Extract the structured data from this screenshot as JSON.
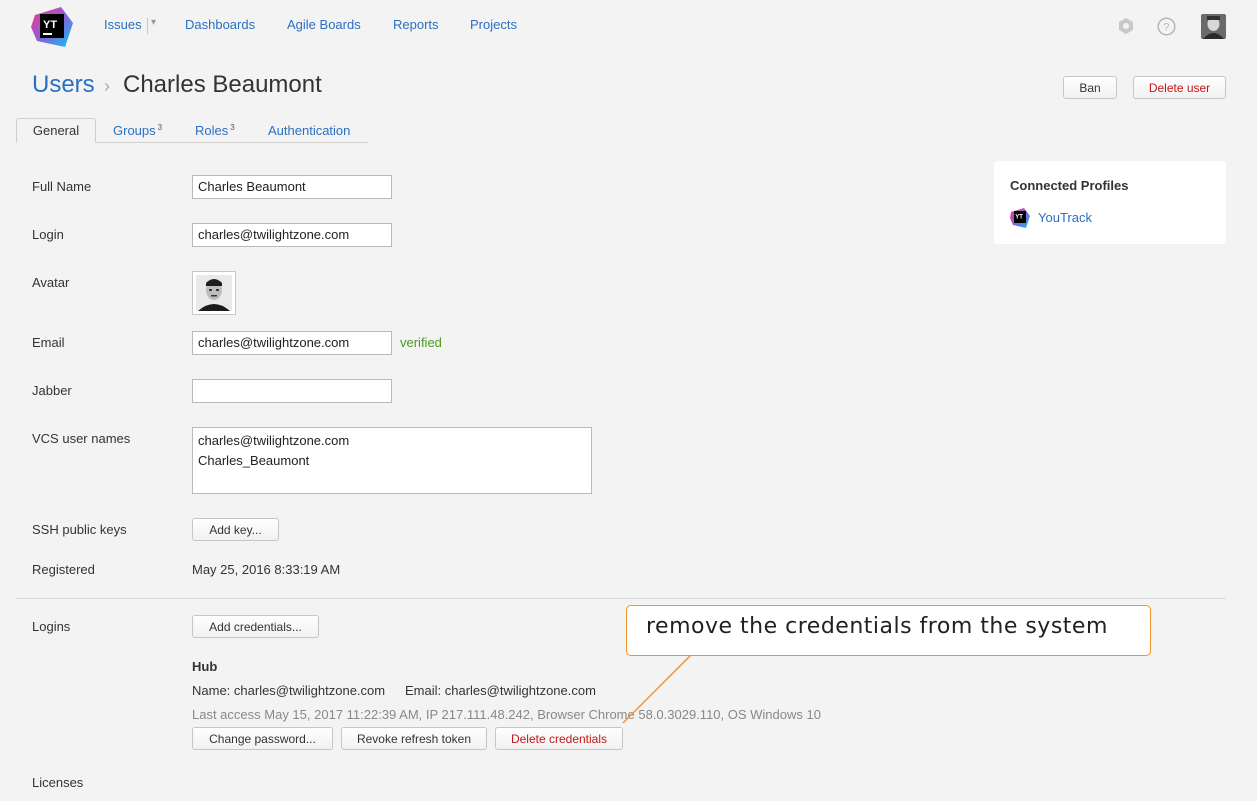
{
  "nav": {
    "items": [
      {
        "label": "Issues"
      },
      {
        "label": "Dashboards"
      },
      {
        "label": "Agile Boards"
      },
      {
        "label": "Reports"
      },
      {
        "label": "Projects"
      }
    ],
    "logo_text": "YT",
    "icons": [
      "hub-settings-icon",
      "help-icon",
      "user-avatar"
    ]
  },
  "header": {
    "breadcrumb": "Users",
    "separator": "›",
    "title": "Charles Beaumont",
    "ban_label": "Ban",
    "delete_user_label": "Delete user"
  },
  "tabs": [
    {
      "label": "General",
      "count": ""
    },
    {
      "label": "Groups",
      "count": "3"
    },
    {
      "label": "Roles",
      "count": "3"
    },
    {
      "label": "Authentication",
      "count": ""
    }
  ],
  "form": {
    "full_name_label": "Full Name",
    "full_name_value": "Charles Beaumont",
    "login_label": "Login",
    "login_value": "charles@twilightzone.com",
    "avatar_label": "Avatar",
    "email_label": "Email",
    "email_value": "charles@twilightzone.com",
    "email_status": "verified",
    "jabber_label": "Jabber",
    "jabber_value": "",
    "vcs_label": "VCS user names",
    "vcs_values": [
      "charles@twilightzone.com",
      "Charles_Beaumont"
    ],
    "ssh_label": "SSH public keys",
    "add_key_label": "Add key...",
    "registered_label": "Registered",
    "registered_value": "May 25, 2016 8:33:19 AM",
    "logins_label": "Logins",
    "add_credentials_label": "Add credentials...",
    "licenses_label": "Licenses"
  },
  "credential": {
    "provider": "Hub",
    "name_text": "Name: charles@twilightzone.com",
    "email_text": "Email: charles@twilightzone.com",
    "last_access": "Last access May 15, 2017 11:22:39 AM, IP 217.111.48.242, Browser Chrome 58.0.3029.110, OS Windows 10",
    "change_password_label": "Change password...",
    "revoke_token_label": "Revoke refresh token",
    "delete_credentials_label": "Delete credentials"
  },
  "connected_profiles": {
    "title": "Connected Profiles",
    "items": [
      {
        "label": "YouTrack"
      }
    ]
  },
  "callout": {
    "text": "remove the credentials from the system",
    "border_color": "#f0942e"
  },
  "colors": {
    "link": "#2b6fc2",
    "danger": "#c31919",
    "verified": "#4a9a22",
    "background": "#f3f3f3"
  }
}
